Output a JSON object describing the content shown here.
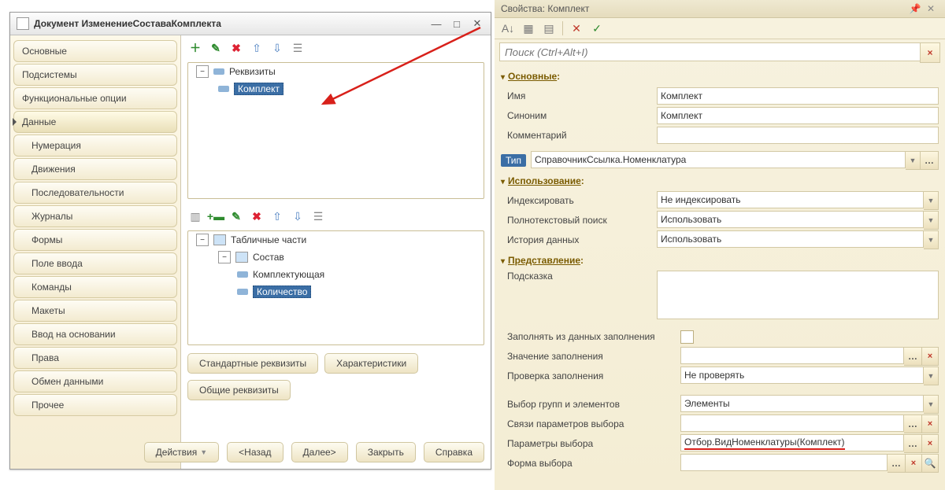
{
  "window": {
    "title": "Документ ИзменениеСоставаКомплекта"
  },
  "tabs": [
    {
      "label": "Основные"
    },
    {
      "label": "Подсистемы"
    },
    {
      "label": "Функциональные опции"
    },
    {
      "label": "Данные",
      "active": true
    },
    {
      "label": "Нумерация",
      "sub": true
    },
    {
      "label": "Движения",
      "sub": true
    },
    {
      "label": "Последовательности",
      "sub": true
    },
    {
      "label": "Журналы",
      "sub": true
    },
    {
      "label": "Формы",
      "sub": true
    },
    {
      "label": "Поле ввода",
      "sub": true
    },
    {
      "label": "Команды",
      "sub": true
    },
    {
      "label": "Макеты",
      "sub": true
    },
    {
      "label": "Ввод на основании",
      "sub": true
    },
    {
      "label": "Права",
      "sub": true
    },
    {
      "label": "Обмен данными",
      "sub": true
    },
    {
      "label": "Прочее",
      "sub": true
    }
  ],
  "tree1": {
    "root": "Реквизиты",
    "item": "Комплект"
  },
  "tree2": {
    "root": "Табличные части",
    "group": "Состав",
    "items": [
      "Комплектующая",
      "Количество"
    ]
  },
  "buttons": {
    "std_req": "Стандартные реквизиты",
    "char": "Характеристики",
    "common_req": "Общие реквизиты",
    "actions": "Действия",
    "back": "<Назад",
    "next": "Далее>",
    "close": "Закрыть",
    "help": "Справка"
  },
  "props": {
    "title": "Свойства: Комплект",
    "search_ph": "Поиск (Ctrl+Alt+I)",
    "sections": {
      "main": "Основные",
      "use": "Использование",
      "pres": "Представление"
    },
    "main": {
      "name_lbl": "Имя",
      "name_val": "Комплект",
      "syn_lbl": "Синоним",
      "syn_val": "Комплект",
      "comm_lbl": "Комментарий",
      "comm_val": "",
      "type_lbl": "Тип",
      "type_val": "СправочникСсылка.Номенклатура"
    },
    "use": {
      "index_lbl": "Индексировать",
      "index_val": "Не индексировать",
      "fts_lbl": "Полнотекстовый поиск",
      "fts_val": "Использовать",
      "hist_lbl": "История данных",
      "hist_val": "Использовать"
    },
    "pres": {
      "hint_lbl": "Подсказка",
      "hint_val": "",
      "fill_from_lbl": "Заполнять из данных заполнения",
      "fill_val_lbl": "Значение заполнения",
      "fill_val_val": "",
      "check_lbl": "Проверка заполнения",
      "check_val": "Не проверять",
      "groups_lbl": "Выбор групп и элементов",
      "groups_val": "Элементы",
      "links_lbl": "Связи параметров выбора",
      "links_val": "",
      "params_lbl": "Параметры выбора",
      "params_val": "Отбор.ВидНоменклатуры(Комплект)",
      "form_lbl": "Форма выбора",
      "form_val": ""
    }
  }
}
